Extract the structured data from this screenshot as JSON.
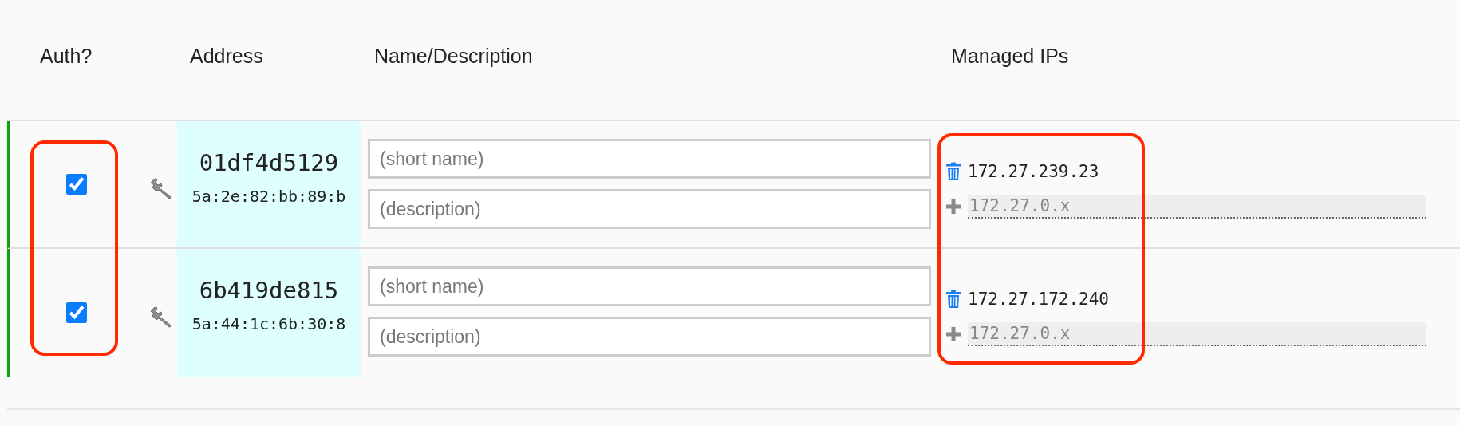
{
  "columns": [
    "Auth?",
    "Address",
    "Name/Description",
    "Managed IPs"
  ],
  "devices": [
    {
      "online": true,
      "authorized": true,
      "id": "01df4d5129",
      "mac": "5a:2e:82:bb:89:b",
      "name_placeholder": "(short name)",
      "description_placeholder": "(description)",
      "managed_ips": [
        "172.27.239.23"
      ],
      "new_ip_placeholder": "172.27.0.x"
    },
    {
      "online": true,
      "authorized": true,
      "id": "6b419de815",
      "mac": "5a:44:1c:6b:30:8",
      "name_placeholder": "(short name)",
      "description_placeholder": "(description)",
      "managed_ips": [
        "172.27.172.240"
      ],
      "new_ip_placeholder": "172.27.0.x"
    }
  ]
}
